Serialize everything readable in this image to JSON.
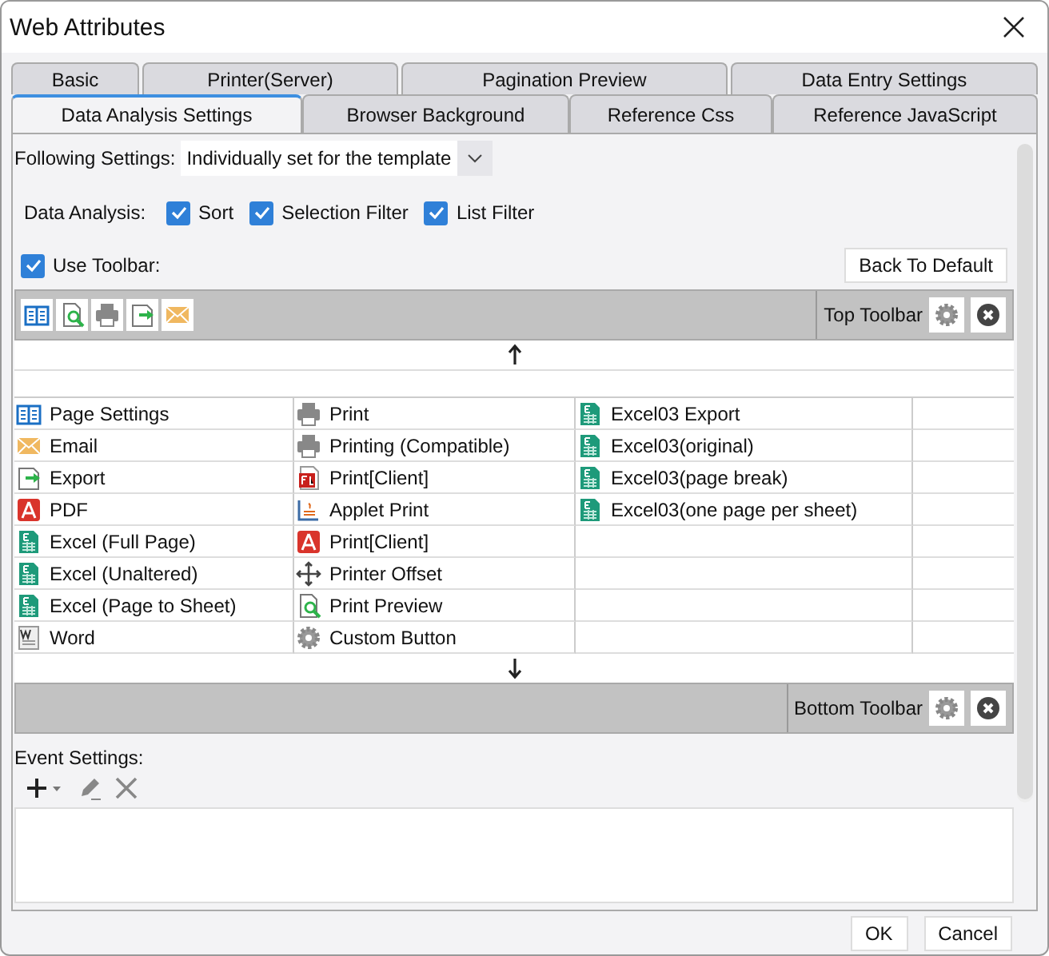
{
  "window": {
    "title": "Web Attributes"
  },
  "tabs_row_1": [
    {
      "label": "Basic",
      "selected": false
    },
    {
      "label": "Printer(Server)",
      "selected": false
    },
    {
      "label": "Pagination Preview",
      "selected": false
    },
    {
      "label": "Data Entry Settings",
      "selected": false
    }
  ],
  "tabs_row_2": [
    {
      "label": "Data Analysis Settings",
      "selected": true
    },
    {
      "label": "Browser Background",
      "selected": false
    },
    {
      "label": "Reference Css",
      "selected": false
    },
    {
      "label": "Reference JavaScript",
      "selected": false
    }
  ],
  "following_settings": {
    "label": "Following Settings:",
    "value": "Individually set for the template"
  },
  "data_analysis": {
    "label": "Data Analysis:",
    "options": [
      {
        "label": "Sort",
        "checked": true
      },
      {
        "label": "Selection Filter",
        "checked": true
      },
      {
        "label": "List Filter",
        "checked": true
      }
    ]
  },
  "use_toolbar": {
    "label": "Use Toolbar:",
    "checked": true
  },
  "back_to_default": "Back To Default",
  "top_toolbar": {
    "label": "Top Toolbar",
    "buttons": [
      {
        "kind": "book"
      },
      {
        "kind": "preview"
      },
      {
        "kind": "print"
      },
      {
        "kind": "export"
      },
      {
        "kind": "mail"
      }
    ]
  },
  "button_grid": [
    [
      {
        "label": "Page Settings",
        "kind": "book"
      },
      {
        "label": "Email",
        "kind": "mail"
      },
      {
        "label": "Export",
        "kind": "export"
      },
      {
        "label": "PDF",
        "kind": "pdf"
      },
      {
        "label": "Excel (Full Page)",
        "kind": "excel"
      },
      {
        "label": "Excel (Unaltered)",
        "kind": "excel"
      },
      {
        "label": "Excel (Page to Sheet)",
        "kind": "excel"
      },
      {
        "label": "Word",
        "kind": "word"
      }
    ],
    [
      {
        "label": "Print",
        "kind": "print"
      },
      {
        "label": "Printing (Compatible)",
        "kind": "print"
      },
      {
        "label": "Print[Client]",
        "kind": "flash"
      },
      {
        "label": "Applet Print",
        "kind": "applet"
      },
      {
        "label": "Print[Client]",
        "kind": "pdf"
      },
      {
        "label": "Printer Offset",
        "kind": "move"
      },
      {
        "label": "Print Preview",
        "kind": "preview"
      },
      {
        "label": "Custom Button",
        "kind": "gear"
      }
    ],
    [
      {
        "label": "Excel03 Export",
        "kind": "excel"
      },
      {
        "label": "Excel03(original)",
        "kind": "excel"
      },
      {
        "label": "Excel03(page break)",
        "kind": "excel"
      },
      {
        "label": "Excel03(one page per sheet)",
        "kind": "excel"
      }
    ]
  ],
  "bottom_toolbar": {
    "label": "Bottom Toolbar"
  },
  "event_settings": {
    "label": "Event Settings:"
  },
  "buttons": [
    "OK",
    "Cancel"
  ]
}
